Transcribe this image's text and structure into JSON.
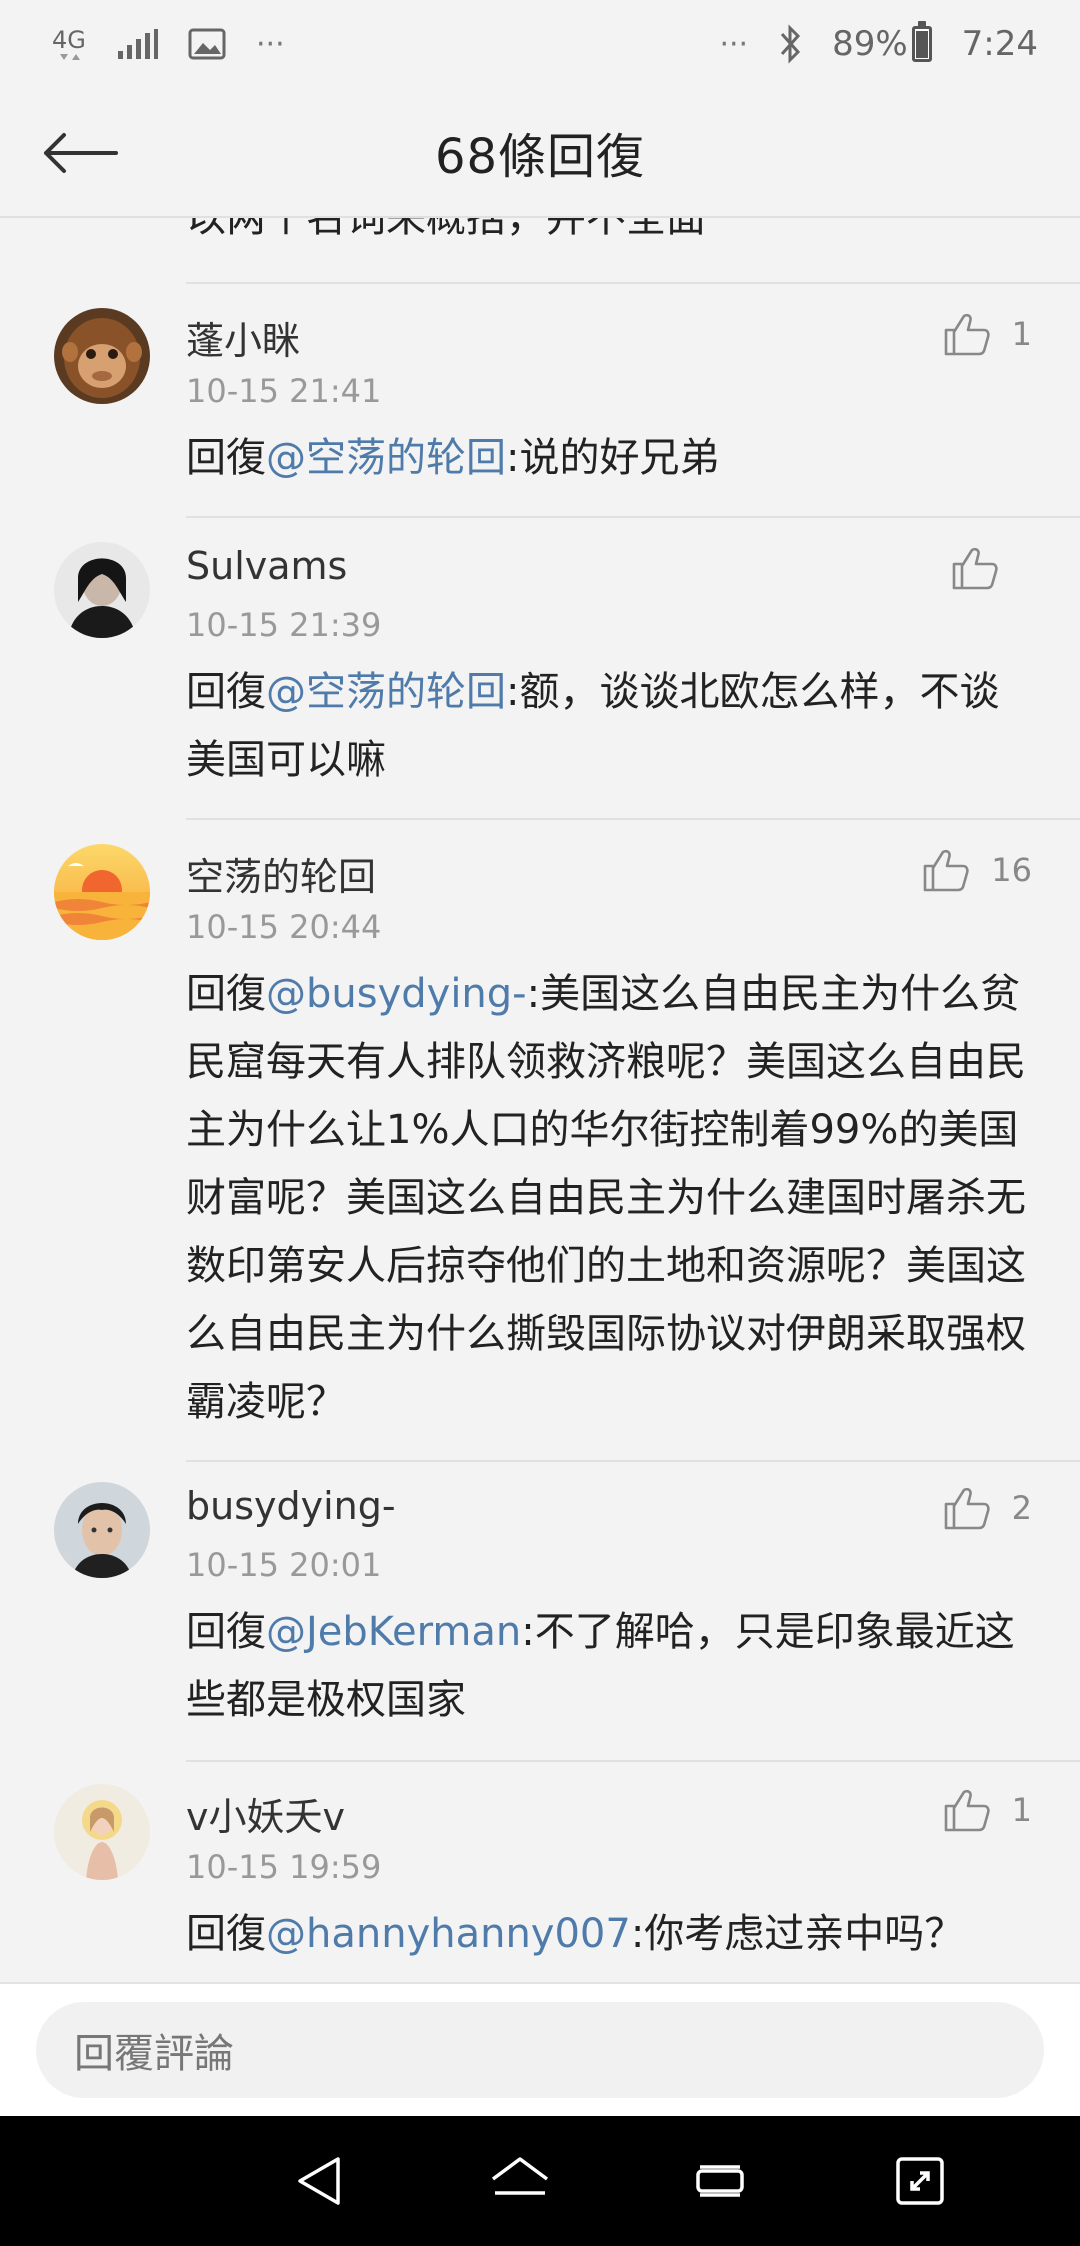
{
  "status_bar": {
    "network": "4G",
    "battery": "89%",
    "battery_level": 0.89,
    "time": "7:24",
    "more": "···",
    "more_left": "···"
  },
  "header": {
    "title": "68條回復"
  },
  "partial_text": "以两个名词来概括，并不全面",
  "comments": [
    {
      "user": "蓬小眯",
      "time": "10-15 21:41",
      "likes": "1",
      "reply_prefix": "回復",
      "mention": "@空荡的轮回",
      "text": ":说的好兄弟",
      "avatar": "orangutan"
    },
    {
      "user": "Sulvams",
      "time": "10-15 21:39",
      "likes": "",
      "reply_prefix": "回復",
      "mention": "@空荡的轮回",
      "text": ":额，谈谈北欧怎么样，不谈美国可以嘛",
      "avatar": "person-dark"
    },
    {
      "user": "空荡的轮回",
      "time": "10-15 20:44",
      "likes": "16",
      "reply_prefix": "回復",
      "mention": "@busydying-",
      "text": ":美国这么自由民主为什么贫民窟每天有人排队领救济粮呢？美国这么自由民主为什么让1%人口的华尔街控制着99%的美国财富呢？美国这么自由民主为什么建国时屠杀无数印第安人后掠夺他们的土地和资源呢？美国这么自由民主为什么撕毁国际协议对伊朗采取强权霸凌呢？",
      "avatar": "sunset"
    },
    {
      "user": "busydying-",
      "time": "10-15 20:01",
      "likes": "2",
      "reply_prefix": "回復",
      "mention": "@JebKerman",
      "text": ":不了解哈，只是印象最近这些都是极权国家",
      "avatar": "person-face"
    },
    {
      "user": "v小妖夭v",
      "time": "10-15 19:59",
      "likes": "1",
      "reply_prefix": "回復",
      "mention": "@hannyhanny007",
      "text": ":你考虑过亲中吗？",
      "avatar": "illustration"
    }
  ],
  "reply_bar": {
    "placeholder": "回覆評論"
  },
  "colors": {
    "mention": "#4f7bab",
    "background": "#f3f3f3",
    "divider": "#e0e0e0"
  }
}
